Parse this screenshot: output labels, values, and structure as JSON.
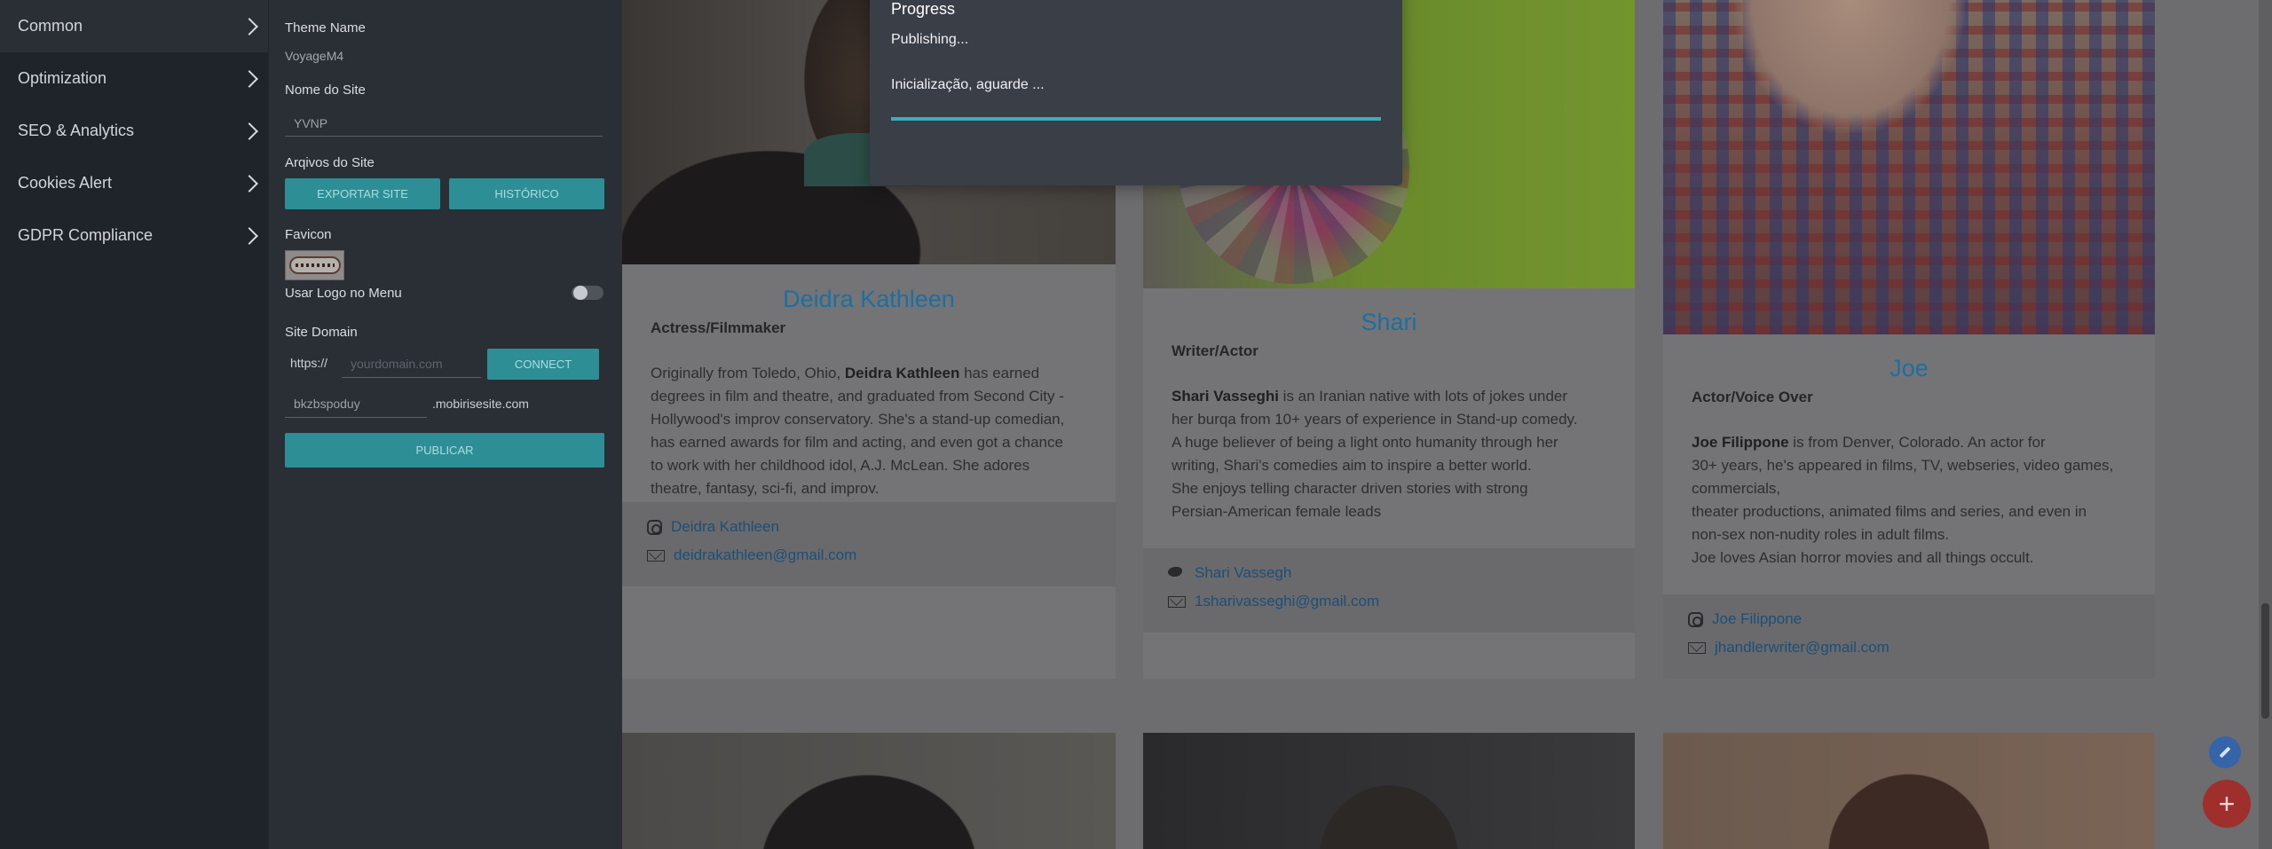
{
  "nav": {
    "items": [
      {
        "label": "Common"
      },
      {
        "label": "Optimization"
      },
      {
        "label": "SEO & Analytics"
      },
      {
        "label": "Cookies Alert"
      },
      {
        "label": "GDPR Compliance"
      }
    ]
  },
  "panel": {
    "theme_name_label": "Theme Name",
    "theme_name_value": "VoyageM4",
    "site_name_label": "Nome do Site",
    "site_name_value": "YVNP",
    "site_files_label": "Arqivos do Site",
    "export_button": "EXPORTAR SITE",
    "history_button": "HISTÓRICO",
    "favicon_label": "Favicon",
    "logo_menu_label": "Usar Logo no Menu",
    "logo_menu_enabled": false,
    "domain_label": "Site Domain",
    "domain_prefix": "https://",
    "domain_placeholder": "yourdomain.com",
    "connect_button": "CONNECT",
    "subdomain_value": "bkzbspoduy",
    "subdomain_suffix": ".mobirisesite.com",
    "publish_button": "PUBLICAR"
  },
  "dialog": {
    "title": "Progress",
    "status": "Publishing...",
    "message": "Inicialização, aguarde ...",
    "progress_percent": 100
  },
  "cards": [
    {
      "name": "Deidra Kathleen",
      "role": "Actress/Filmmaker",
      "bio_bold": "Deidra Kathleen",
      "bio_lines": [
        "Originally from Toledo, Ohio, ",
        " has earned",
        "degrees in film and theatre, and graduated from Second City -",
        "Hollywood's improv conservatory. She's a stand-up comedian,",
        "has earned awards for film and acting, and even got a chance",
        "to work with her childhood idol, A.J. McLean. She adores",
        "theatre, fantasy, sci-fi, and improv."
      ],
      "link1": "Deidra Kathleen",
      "link1_icon": "instagram-icon",
      "link2": "deidrakathleen@gmail.com",
      "link2_icon": "mail-icon"
    },
    {
      "name": "Shari",
      "role": "Writer/Actor",
      "bio_bold": "Shari Vasseghi",
      "bio_lines": [
        "",
        " is an Iranian native with lots of jokes under",
        "her burqa from 10+ years of experience in Stand-up comedy.",
        "A huge believer of being a light onto humanity through her",
        "writing, Shari's comedies aim to inspire a better world.",
        "She enjoys telling character driven stories with strong",
        "Persian-American female leads"
      ],
      "link1": "Shari Vassegh",
      "link1_icon": "twitter-icon",
      "link2": "1sharivasseghi@gmail.com",
      "link2_icon": "mail-icon"
    },
    {
      "name": "Joe",
      "role": "Actor/Voice Over",
      "bio_bold": "Joe Filippone",
      "bio_lines": [
        "",
        " is from Denver, Colorado. An actor for",
        "30+ years, he's appeared in films, TV, webseries, video games,",
        "commercials,",
        "theater productions, animated films and series, and even in",
        "non-sex non-nudity roles in adult films.",
        "Joe loves Asian horror movies and all things occult."
      ],
      "link1": "Joe Filippone",
      "link1_icon": "instagram-icon",
      "link2": "jhandlerwriter@gmail.com",
      "link2_icon": "mail-icon"
    }
  ],
  "fab": {
    "add_symbol": "+"
  }
}
